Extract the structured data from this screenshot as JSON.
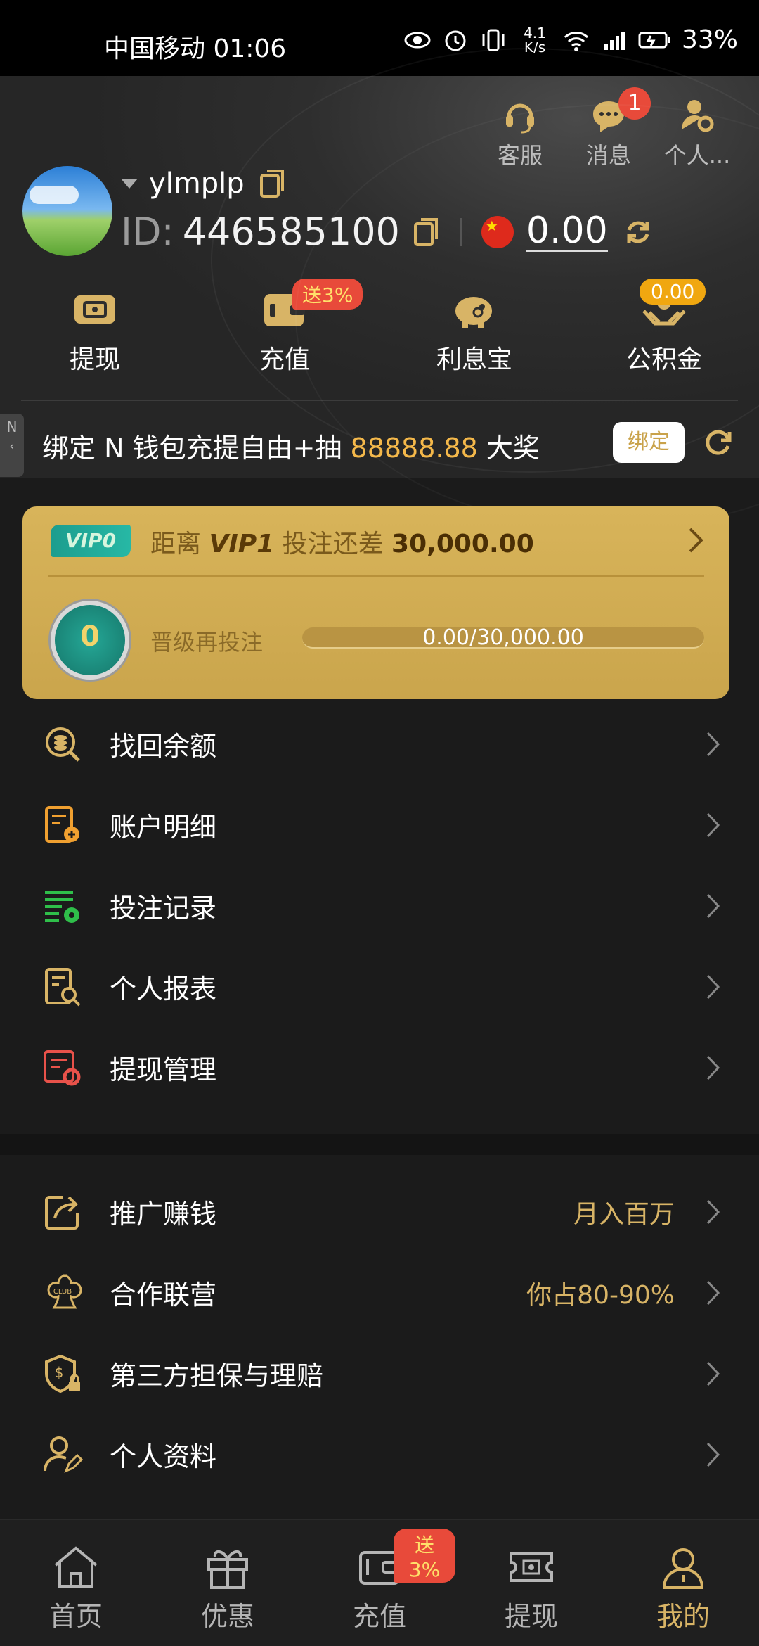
{
  "status_bar": {
    "carrier_time": "中国移动 01:06",
    "net_speed": "4.1 K/s",
    "battery": "33%"
  },
  "header": {
    "top_actions": [
      {
        "label": "客服",
        "icon": "headset-icon"
      },
      {
        "label": "消息",
        "icon": "chat-bubble-icon",
        "badge": "1"
      },
      {
        "label": "个人...",
        "icon": "user-gear-icon"
      }
    ],
    "username": "ylmplp",
    "id_label": "ID:",
    "id_value": "446585100",
    "balance": "0.00",
    "quick_actions": [
      {
        "label": "提现",
        "icon": "withdraw-icon"
      },
      {
        "label": "充值",
        "icon": "wallet-icon",
        "badge": "送3%"
      },
      {
        "label": "利息宝",
        "icon": "piggy-bank-icon"
      },
      {
        "label": "公积金",
        "icon": "fund-hands-icon",
        "badge": "0.00"
      }
    ]
  },
  "promo": {
    "side_tab": "N",
    "text_before": "绑定 N",
    "text_mid": " 钱包充提自由+抽 ",
    "amount": "88888.88",
    "text_after": " 大奖",
    "bind_label": "绑定"
  },
  "vip": {
    "tag": "VIP0",
    "prefix": "距离 ",
    "next_level": "VIP1",
    "middle": " 投注还差 ",
    "remaining": "30,000.00",
    "medal_level": "0",
    "upgrade_label": "晋级再投注",
    "progress_text": "0.00/30,000.00",
    "progress": 0
  },
  "menu_primary": [
    {
      "label": "找回余额",
      "icon": "search-coin-icon"
    },
    {
      "label": "账户明细",
      "icon": "account-detail-icon"
    },
    {
      "label": "投注记录",
      "icon": "bet-record-icon"
    },
    {
      "label": "个人报表",
      "icon": "report-search-icon"
    },
    {
      "label": "提现管理",
      "icon": "withdraw-settings-icon"
    }
  ],
  "menu_secondary": [
    {
      "label": "推广赚钱",
      "extra": "月入百万",
      "icon": "share-icon"
    },
    {
      "label": "合作联营",
      "extra": "你占80-90%",
      "icon": "club-icon"
    },
    {
      "label": "第三方担保与理赔",
      "extra": "",
      "icon": "shield-dollar-icon"
    },
    {
      "label": "个人资料",
      "extra": "",
      "icon": "user-edit-icon"
    }
  ],
  "bottom_nav": [
    {
      "label": "首页",
      "icon": "home-icon"
    },
    {
      "label": "优惠",
      "icon": "gift-icon"
    },
    {
      "label": "充值",
      "icon": "wallet-icon",
      "badge": "送3%"
    },
    {
      "label": "提现",
      "icon": "ticket-icon"
    },
    {
      "label": "我的",
      "icon": "user-icon",
      "active": true
    }
  ],
  "colors": {
    "gold": "#d8b466",
    "background": "#1b1b1b",
    "badge_red": "#e84a3a"
  }
}
